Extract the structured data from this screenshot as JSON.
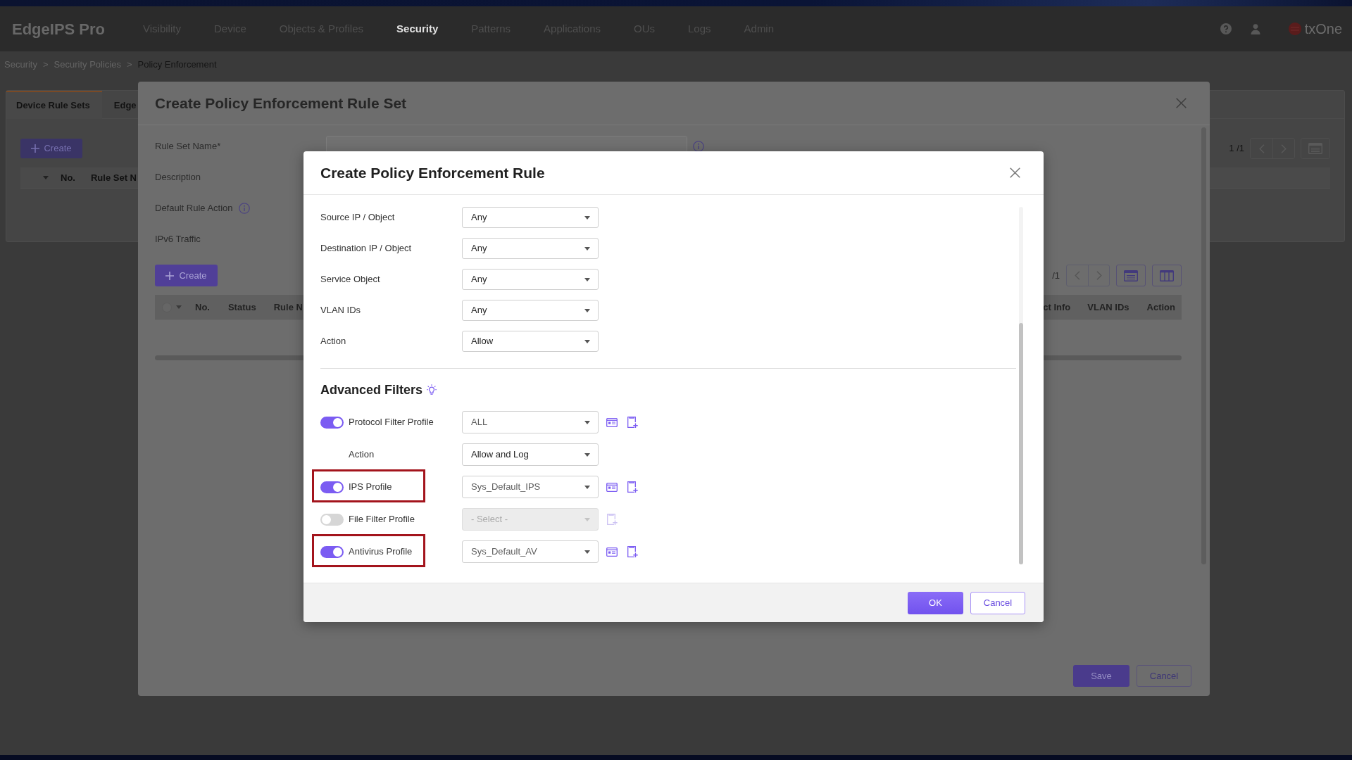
{
  "top_bar": {
    "app_name": "EdgeIPS Pro",
    "menu": [
      {
        "label": "Visibility",
        "selected": false
      },
      {
        "label": "Device",
        "selected": false
      },
      {
        "label": "Objects & Profiles",
        "selected": false
      },
      {
        "label": "Security",
        "selected": true
      },
      {
        "label": "Patterns",
        "selected": false
      },
      {
        "label": "Applications",
        "selected": false
      },
      {
        "label": "OUs",
        "selected": false
      },
      {
        "label": "Logs",
        "selected": false
      },
      {
        "label": "Admin",
        "selected": false
      }
    ],
    "brand": "txOne"
  },
  "breadcrumb": {
    "items": [
      "Security",
      "Security Policies",
      "Policy Enforcement"
    ],
    "separator": ">"
  },
  "page": {
    "tabs": [
      {
        "label": "Device Rule Sets",
        "selected": true
      },
      {
        "label": "Edge",
        "selected": false
      }
    ],
    "create_button": "Create",
    "pagination": "1 /1",
    "table": {
      "columns": [
        "No.",
        "Rule Set N"
      ]
    }
  },
  "rule_set_dialog": {
    "title": "Create Policy Enforcement Rule Set",
    "fields": [
      {
        "kind": "input",
        "label": "Rule Set Name*"
      },
      {
        "kind": "plain",
        "label": "Description"
      },
      {
        "kind": "info",
        "label": "Default Rule Action"
      },
      {
        "kind": "plain",
        "label": "IPv6 Traffic"
      }
    ],
    "create_button": "Create",
    "pagination": "/1",
    "table": {
      "select_all": {
        "checked": false
      },
      "columns": [
        "No.",
        "Status",
        "Rule N",
        "ct Info",
        "VLAN IDs",
        "Action"
      ]
    },
    "buttons": [
      {
        "label": "Save",
        "kind": "primary"
      },
      {
        "label": "Cancel",
        "kind": "secondary"
      }
    ]
  },
  "rule_dialog": {
    "title": "Create Policy Enforcement Rule",
    "fields": [
      {
        "label": "Source IP / Object",
        "value": "Any"
      },
      {
        "label": "Destination IP / Object",
        "value": "Any"
      },
      {
        "label": "Service Object",
        "value": "Any"
      },
      {
        "label": "VLAN IDs",
        "value": "Any"
      },
      {
        "label": "Action",
        "value": "Allow"
      }
    ],
    "advanced_title": "Advanced Filters",
    "filters": [
      {
        "kind": "profile",
        "label": "Protocol Filter Profile",
        "on": true,
        "value": "ALL",
        "highlighted": false
      },
      {
        "kind": "option",
        "label": "Action",
        "value": "Allow and Log"
      },
      {
        "kind": "profile",
        "label": "IPS Profile",
        "on": true,
        "value": "Sys_Default_IPS",
        "highlighted": true
      },
      {
        "kind": "profile",
        "label": "File Filter Profile",
        "on": false,
        "value": "- Select -",
        "highlighted": false
      },
      {
        "kind": "profile",
        "label": "Antivirus Profile",
        "on": true,
        "value": "Sys_Default_AV",
        "highlighted": true
      }
    ],
    "buttons": [
      {
        "label": "OK",
        "kind": "primary"
      },
      {
        "label": "Cancel",
        "kind": "secondary"
      }
    ]
  }
}
